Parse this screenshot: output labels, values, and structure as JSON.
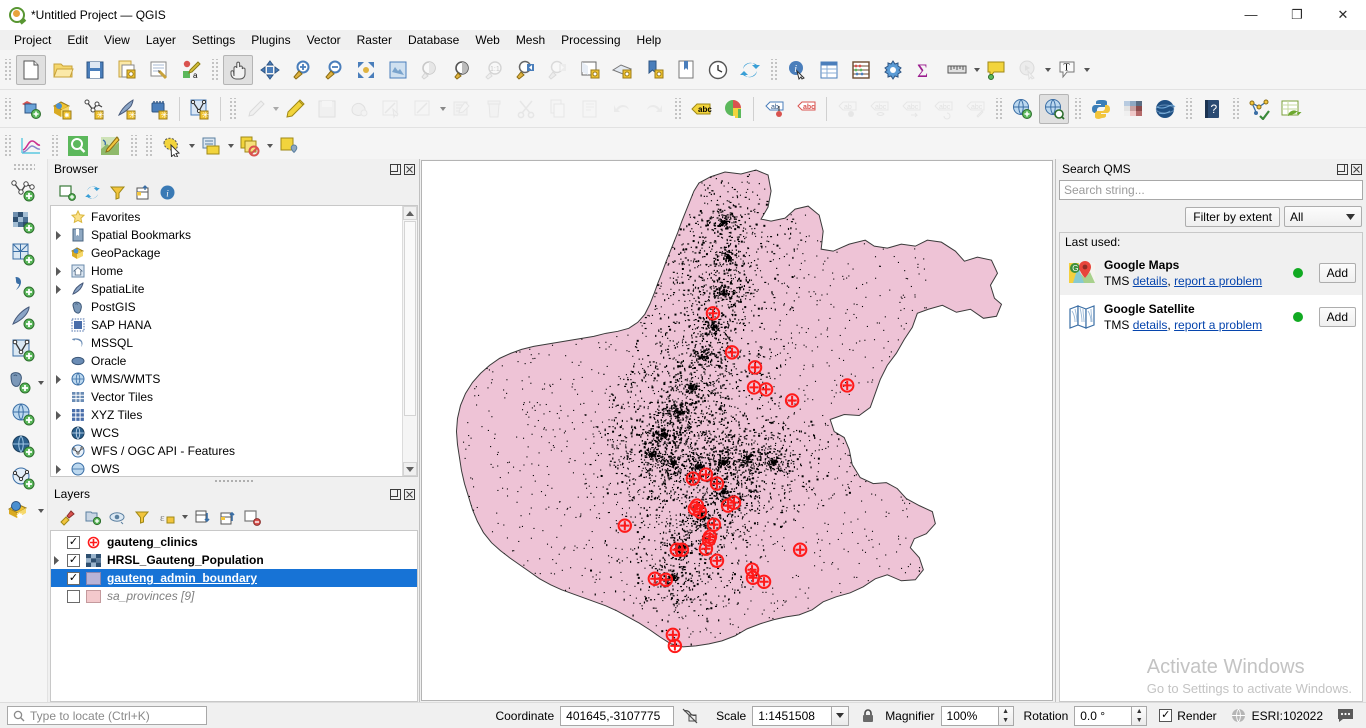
{
  "window": {
    "title": "*Untitled Project — QGIS",
    "app_icon": "qgis-logo-icon",
    "minimize": "—",
    "maximize": "❐",
    "close": "✕"
  },
  "menubar": {
    "items": [
      {
        "label": "Project",
        "accel": "P"
      },
      {
        "label": "Edit",
        "accel": "E"
      },
      {
        "label": "View",
        "accel": "V"
      },
      {
        "label": "Layer",
        "accel": "L"
      },
      {
        "label": "Settings",
        "accel": "S"
      },
      {
        "label": "Plugins",
        "accel": "P"
      },
      {
        "label": "Vector",
        "accel": "o"
      },
      {
        "label": "Raster",
        "accel": "R"
      },
      {
        "label": "Database",
        "accel": "D"
      },
      {
        "label": "Web",
        "accel": "W"
      },
      {
        "label": "Mesh",
        "accel": "M"
      },
      {
        "label": "Processing",
        "accel": "c"
      },
      {
        "label": "Help",
        "accel": "H"
      }
    ]
  },
  "toolbars": {
    "row1": [
      "new-project-icon",
      "open-project-icon",
      "save-project-icon",
      "save-project-as-icon",
      "new-print-layout-icon",
      "style-manager-icon",
      "pan-map-icon",
      "pan-to-selection-icon",
      "zoom-in-icon",
      "zoom-out-icon",
      "zoom-full-icon",
      "zoom-to-selection-icon",
      "zoom-to-layer-icon",
      "zoom-native-icon",
      "zoom-last-icon",
      "zoom-next-icon",
      "new-map-view-icon",
      "new-3d-map-view-icon",
      "new-print-layout2-icon",
      "layout-manager-icon",
      "temporal-controller-icon",
      "refresh-icon",
      "identify-features-icon",
      "open-attribute-table-icon",
      "field-calculator-icon",
      "options-icon",
      "statistical-summary-icon",
      "measure-line-icon",
      "map-tips-icon",
      "run-feature-action-icon",
      "new-text-annotation-icon"
    ],
    "row2": [
      "open-data-source-manager-icon",
      "new-geopackage-icon",
      "new-shapefile-icon",
      "new-spatialite-icon",
      "new-gpx-icon",
      "new-virtual-layer-icon",
      "current-edits-icon",
      "toggle-editing-icon",
      "save-layer-edits-icon",
      "add-polygon-feature-icon",
      "vertex-tool-icon",
      "modify-attributes-icon",
      "delete-selected-icon",
      "cut-features-icon",
      "copy-features-icon",
      "paste-features-icon",
      "undo-icon",
      "redo-icon",
      "labeling-icon",
      "style-diagram-icon",
      "highlight-pinned-labels-icon",
      "unplaced-labels-icon",
      "pin-labels-icon",
      "show-hide-labels-icon",
      "move-label-icon",
      "rotate-label-icon",
      "change-label-icon",
      "metasearch-icon",
      "qms-search-icon",
      "python-console-icon",
      "plugin-manager-icon",
      "globe-icon",
      "help-icon",
      "processing-toolbox-icon",
      "refresh-attribute-table-icon"
    ],
    "row3": [
      "data-plotly-icon",
      "qms-magnifier-icon",
      "osm-editor-icon",
      "select-features-icon",
      "select-by-expression-icon",
      "deselect-features-icon",
      "new-map-note-icon"
    ],
    "vertical": [
      "add-vector-layer-icon",
      "add-raster-layer-icon",
      "add-mesh-layer-icon",
      "add-delimited-text-layer-icon",
      "add-spatialite-layer-icon",
      "add-virtual-layer-icon",
      "add-postgis-layer-icon",
      "add-wms-layer-icon",
      "add-wcs-layer-icon",
      "add-wfs-layer-icon",
      "add-arcgis-server-layer-icon"
    ]
  },
  "browser": {
    "title": "Browser",
    "toolbar": [
      "add-layer-icon",
      "refresh-icon",
      "filter-browser-icon",
      "collapse-all-icon",
      "properties-info-icon"
    ],
    "items": [
      {
        "label": "Favorites",
        "icon": "star-icon",
        "expandable": false
      },
      {
        "label": "Spatial Bookmarks",
        "icon": "bookmark-icon",
        "expandable": true
      },
      {
        "label": "GeoPackage",
        "icon": "geopackage-icon",
        "expandable": false
      },
      {
        "label": "Home",
        "icon": "home-icon",
        "expandable": true
      },
      {
        "label": "SpatiaLite",
        "icon": "spatialite-icon",
        "expandable": true
      },
      {
        "label": "PostGIS",
        "icon": "postgis-icon",
        "expandable": false
      },
      {
        "label": "SAP HANA",
        "icon": "saphana-icon",
        "expandable": false
      },
      {
        "label": "MSSQL",
        "icon": "mssql-icon",
        "expandable": false
      },
      {
        "label": "Oracle",
        "icon": "oracle-icon",
        "expandable": false
      },
      {
        "label": "WMS/WMTS",
        "icon": "wms-icon",
        "expandable": true
      },
      {
        "label": "Vector Tiles",
        "icon": "vector-tiles-icon",
        "expandable": false
      },
      {
        "label": "XYZ Tiles",
        "icon": "xyz-tiles-icon",
        "expandable": true
      },
      {
        "label": "WCS",
        "icon": "wcs-icon",
        "expandable": false
      },
      {
        "label": "WFS / OGC API - Features",
        "icon": "wfs-icon",
        "expandable": false
      },
      {
        "label": "OWS",
        "icon": "ows-icon",
        "expandable": true
      }
    ]
  },
  "layers": {
    "title": "Layers",
    "toolbar": [
      "open-layer-styling-icon",
      "add-group-icon",
      "manage-map-themes-icon",
      "filter-legend-icon",
      "filter-legend-expression-icon",
      "expand-all-icon",
      "collapse-all-icon",
      "remove-layer-icon"
    ],
    "items": [
      {
        "name": "gauteng_clinics",
        "checked": true,
        "expandable": false,
        "symbol": "point-cross-red",
        "selected": false
      },
      {
        "name": "HRSL_Gauteng_Population",
        "checked": true,
        "expandable": true,
        "symbol": "raster-checker",
        "selected": false
      },
      {
        "name": "gauteng_admin_boundary",
        "checked": true,
        "expandable": false,
        "symbol": "polygon-lilac",
        "selected": true
      },
      {
        "name": "sa_provinces [9]",
        "checked": false,
        "expandable": false,
        "symbol": "polygon-pink",
        "selected": false
      }
    ]
  },
  "search_qms": {
    "title": "Search QMS",
    "search_placeholder": "Search string...",
    "search_value": "",
    "filter_button": "Filter by extent",
    "category_selected": "All",
    "header": "Last used:",
    "results": [
      {
        "name": "Google Maps",
        "type": "TMS",
        "details_label": "details",
        "report_label": "report a problem",
        "status": "online",
        "add_label": "Add",
        "icon": "google-maps-icon"
      },
      {
        "name": "Google Satellite",
        "type": "TMS",
        "details_label": "details",
        "report_label": "report a problem",
        "status": "online",
        "add_label": "Add",
        "icon": "google-satellite-icon"
      }
    ]
  },
  "watermark": {
    "line1": "Activate Windows",
    "line2": "Go to Settings to activate Windows."
  },
  "statusbar": {
    "locate_placeholder": "Type to locate (Ctrl+K)",
    "coordinate_label": "Coordinate",
    "coordinate_value": "401645,-3107775",
    "scale_label": "Scale",
    "scale_value": "1:1451508",
    "magnifier_label": "Magnifier",
    "magnifier_value": "100%",
    "rotation_label": "Rotation",
    "rotation_value": "0.0 °",
    "render_label": "Render",
    "render_checked": true,
    "crs_value": "ESRI:102022",
    "messages_icon": "messages-icon",
    "lock_icon": "lock-icon",
    "toggle-extents-icon": "toggle-extents-icon"
  },
  "map": {
    "boundary_fill": "#eec3d6",
    "boundary_stroke": "#3a3a3a",
    "clinic_marker_color": "#ff1a1a",
    "population_dot_color": "#000000",
    "canvas_background": "#ffffff"
  },
  "colors": {
    "selection_blue": "#1773d6",
    "link_blue": "#0645ad",
    "status_green": "#11aa22",
    "toolbar_bg": "#f5f5f5",
    "panel_bg": "#f0f0f0"
  }
}
